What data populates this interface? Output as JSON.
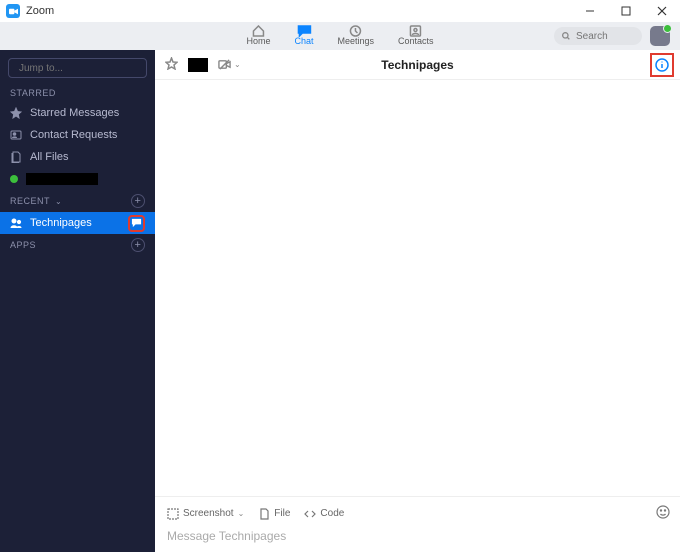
{
  "titlebar": {
    "app_name": "Zoom"
  },
  "nav": {
    "home": "Home",
    "chat": "Chat",
    "meetings": "Meetings",
    "contacts": "Contacts"
  },
  "search": {
    "placeholder": "Search"
  },
  "sidebar": {
    "jump_placeholder": "Jump to...",
    "sections": {
      "starred": "Starred",
      "recent": "Recent",
      "apps": "Apps"
    },
    "starred_items": {
      "starred_messages": "Starred Messages",
      "contact_requests": "Contact Requests",
      "all_files": "All Files"
    },
    "recent_items": {
      "technipages": "Technipages"
    }
  },
  "chat": {
    "title": "Technipages",
    "compose": {
      "screenshot": "Screenshot",
      "file": "File",
      "code": "Code",
      "placeholder": "Message Technipages"
    }
  }
}
